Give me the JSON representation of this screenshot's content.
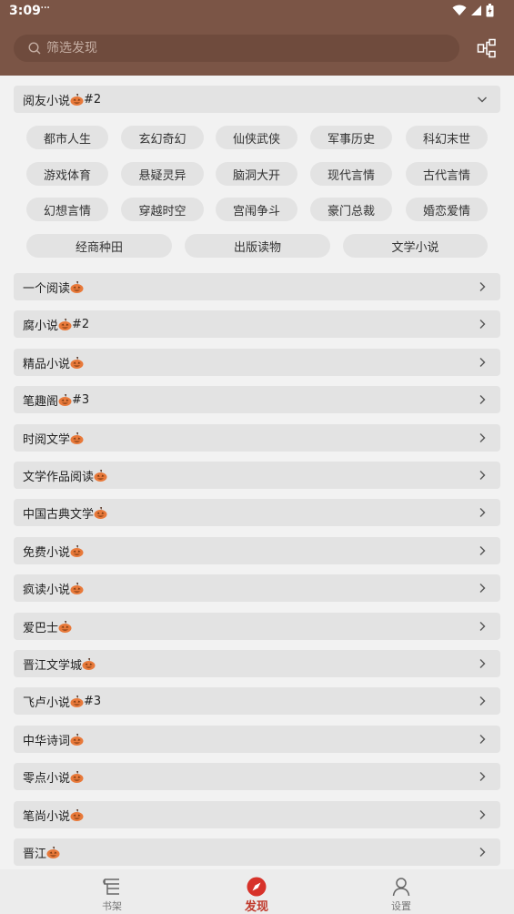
{
  "status": {
    "time": "3:09",
    "dots": "···"
  },
  "search": {
    "placeholder": "筛选发现"
  },
  "open_group": {
    "title": "阅友小说",
    "suffix": "#2",
    "tags": [
      "都市人生",
      "玄幻奇幻",
      "仙侠武侠",
      "军事历史",
      "科幻末世",
      "游戏体育",
      "悬疑灵异",
      "脑洞大开",
      "现代言情",
      "古代言情",
      "幻想言情",
      "穿越时空",
      "宫闱争斗",
      "豪门总裁",
      "婚恋爱情",
      "经商种田",
      "出版读物",
      "文学小说"
    ]
  },
  "sources": [
    {
      "name": "一个阅读",
      "suffix": ""
    },
    {
      "name": "腐小说",
      "suffix": "#2"
    },
    {
      "name": "精品小说",
      "suffix": ""
    },
    {
      "name": "笔趣阁",
      "suffix": "#3"
    },
    {
      "name": "时阅文学",
      "suffix": ""
    },
    {
      "name": "文学作品阅读",
      "suffix": ""
    },
    {
      "name": "中国古典文学",
      "suffix": ""
    },
    {
      "name": "免费小说",
      "suffix": ""
    },
    {
      "name": "疯读小说",
      "suffix": ""
    },
    {
      "name": "爱巴士",
      "suffix": ""
    },
    {
      "name": "晋江文学城",
      "suffix": ""
    },
    {
      "name": "飞卢小说",
      "suffix": "#3"
    },
    {
      "name": "中华诗词",
      "suffix": ""
    },
    {
      "name": "零点小说",
      "suffix": ""
    },
    {
      "name": "笔尚小说",
      "suffix": ""
    },
    {
      "name": "晋江",
      "suffix": ""
    }
  ],
  "nav": {
    "bookshelf": "书架",
    "discover": "发现",
    "settings": "设置"
  },
  "colors": {
    "header": "#7b5546",
    "accent": "#c0392b",
    "pumpkin": "#e8793a"
  }
}
